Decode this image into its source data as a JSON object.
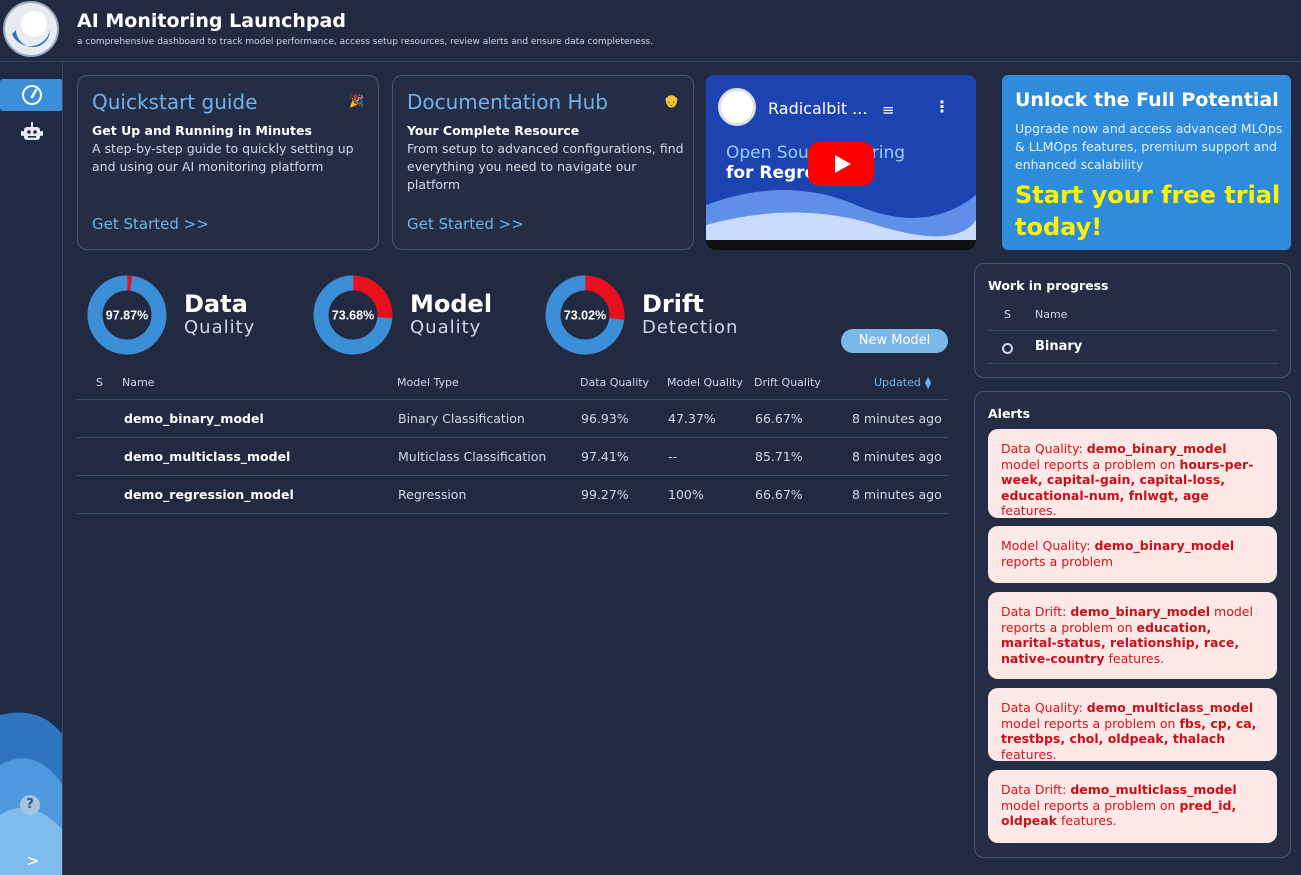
{
  "header": {
    "title": "AI Monitoring Launchpad",
    "subtitle": "a comprehensive dashboard to track model performance, access setup resources, review alerts and ensure data completeness."
  },
  "sidebar": {
    "items": [
      {
        "icon": "gauge-icon",
        "active": true
      },
      {
        "icon": "robot-icon",
        "active": false
      }
    ],
    "help_label": "?",
    "expand_label": ">"
  },
  "cards": [
    {
      "title": "Quickstart guide",
      "emoji": "🎉",
      "subtitle": "Get Up and Running in Minutes",
      "description": "A step-by-step guide to quickly setting up and using our AI monitoring platform",
      "link": "Get Started >>"
    },
    {
      "title": "Documentation Hub",
      "emoji": "👴",
      "subtitle": "Your Complete Resource",
      "description": "From setup to advanced configurations, find everything you need to navigate our platform",
      "link": "Get Started >>"
    }
  ],
  "video": {
    "title": "Radicalbit ...",
    "overlay_line1": "Open Sou      Monitoring",
    "overlay_line2": "for Regre       odels"
  },
  "promo": {
    "title": "Unlock the Full Potential",
    "description": "Upgrade now and access advanced MLOps & LLMOps features, premium support and enhanced scalability",
    "cta": "Start your free trial today!"
  },
  "donuts": [
    {
      "value_label": "97.87%",
      "value": 97.87,
      "main": "Data",
      "sub": "Quality"
    },
    {
      "value_label": "73.68%",
      "value": 73.68,
      "main": "Model",
      "sub": "Quality"
    },
    {
      "value_label": "73.02%",
      "value": 73.02,
      "main": "Drift",
      "sub": "Detection"
    }
  ],
  "colors": {
    "good": "#3a8fd8",
    "bad": "#e8101c",
    "accent": "#6fb3ec"
  },
  "new_model_label": "New Model",
  "table": {
    "headers": [
      "S",
      "Name",
      "Model Type",
      "Data Quality",
      "Model Quality",
      "Drift Quality",
      "Updated"
    ],
    "sort_indicator": "▲▼",
    "rows": [
      {
        "name": "demo_binary_model",
        "type": "Binary Classification",
        "dq": "96.93%",
        "mq": "47.37%",
        "drift": "66.67%",
        "updated": "8 minutes ago"
      },
      {
        "name": "demo_multiclass_model",
        "type": "Multiclass Classification",
        "dq": "97.41%",
        "mq": "--",
        "drift": "85.71%",
        "updated": "8 minutes ago"
      },
      {
        "name": "demo_regression_model",
        "type": "Regression",
        "dq": "99.27%",
        "mq": "100%",
        "drift": "66.67%",
        "updated": "8 minutes ago"
      }
    ]
  },
  "wip": {
    "title": "Work in progress",
    "headers": [
      "S",
      "Name"
    ],
    "rows": [
      {
        "name": "Binary"
      }
    ]
  },
  "alerts": {
    "title": "Alerts",
    "items": [
      {
        "prefix": "Data Quality: ",
        "model": "demo_binary_model",
        "mid": " model reports a problem on ",
        "features": "hours-per-week, capital-gain, capital-loss, educational-num, fnlwgt, age",
        "suffix": " features."
      },
      {
        "prefix": "Model Quality: ",
        "model": "demo_binary_model",
        "mid": " reports a problem",
        "features": "",
        "suffix": ""
      },
      {
        "prefix": "Data Drift: ",
        "model": "demo_binary_model",
        "mid": " model reports a problem on ",
        "features": "education, marital-status, relationship, race, native-country",
        "suffix": " features."
      },
      {
        "prefix": "Data Quality: ",
        "model": "demo_multiclass_model",
        "mid": " model reports a problem on ",
        "features": "fbs, cp, ca, trestbps, chol, oldpeak, thalach",
        "suffix": " features."
      },
      {
        "prefix": "Data Drift: ",
        "model": "demo_multiclass_model",
        "mid": " model reports a problem on ",
        "features": "pred_id, oldpeak",
        "suffix": " features."
      }
    ]
  }
}
